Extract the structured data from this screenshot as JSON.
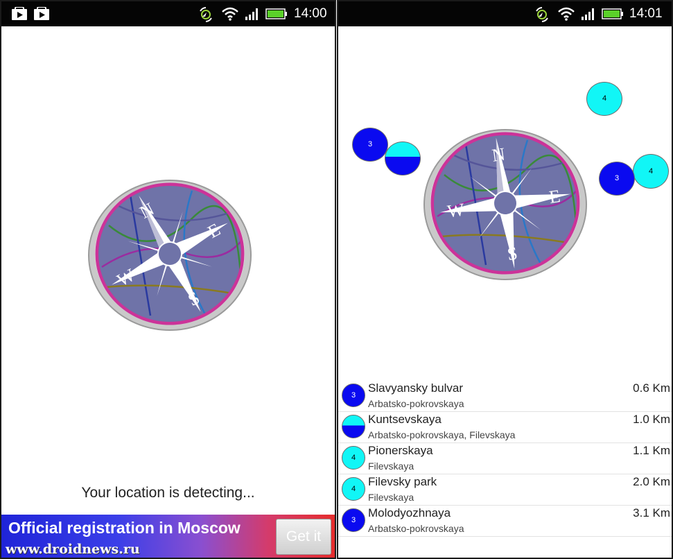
{
  "left_screen": {
    "status_time": "14:00",
    "status_icons": [
      "play-store-icon",
      "play-store-icon",
      "location-sync-icon",
      "wifi-icon",
      "signal-icon",
      "battery-icon"
    ],
    "compass_letters": {
      "n": "N",
      "e": "E",
      "s": "S",
      "w": "W"
    },
    "detecting_text": "Your location is detecting...",
    "ad": {
      "title": "Official registration in Moscow",
      "button": "Get it",
      "watermark": "www.droidnews.ru"
    }
  },
  "right_screen": {
    "status_time": "14:01",
    "status_icons": [
      "location-sync-icon",
      "wifi-icon",
      "signal-icon",
      "battery-icon"
    ],
    "compass_letters": {
      "n": "N",
      "e": "E",
      "s": "S",
      "w": "W"
    },
    "markers": [
      "4",
      "3",
      "4",
      "3"
    ],
    "stations": [
      {
        "name": "Slavyansky bulvar",
        "lines": "Arbatsko-pokrovskaya",
        "distance": "0.6 Km",
        "badge": "3",
        "badge_style": "blue"
      },
      {
        "name": "Kuntsevskaya",
        "lines": "Arbatsko-pokrovskaya, Filevskaya",
        "distance": "1.0 Km",
        "badge": "",
        "badge_style": "split"
      },
      {
        "name": "Pionerskaya",
        "lines": "Filevskaya",
        "distance": "1.1 Km",
        "badge": "4",
        "badge_style": "cyan"
      },
      {
        "name": "Filevsky park",
        "lines": "Filevskaya",
        "distance": "2.0 Km",
        "badge": "4",
        "badge_style": "cyan"
      },
      {
        "name": "Molodyozhnaya",
        "lines": "Arbatsko-pokrovskaya",
        "distance": "3.1 Km",
        "badge": "3",
        "badge_style": "blue"
      }
    ]
  },
  "colors": {
    "line3_blue": "#0a0af0",
    "line4_cyan": "#11f6f6",
    "compass_ring": "#cc3399",
    "status_bar": "#050505"
  }
}
